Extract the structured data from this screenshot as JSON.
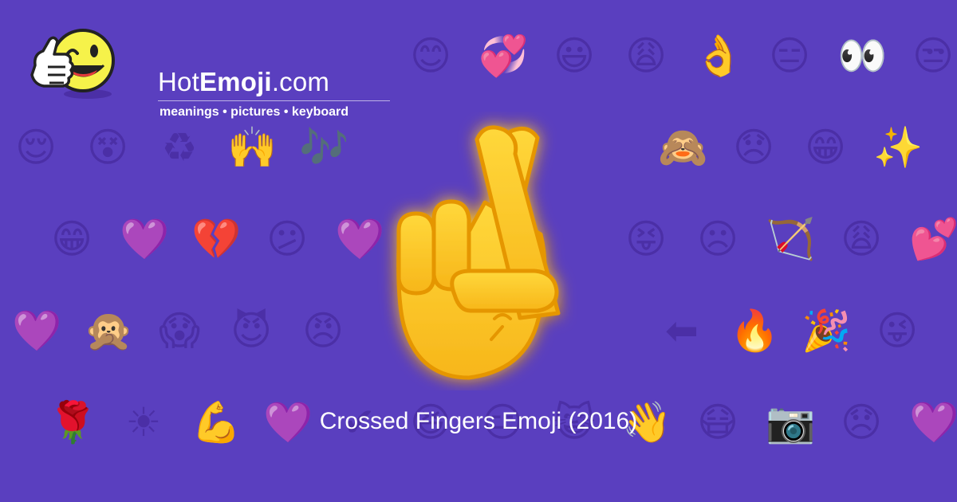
{
  "brand": {
    "name_regular_start": "Hot",
    "name_bold": "Emoji",
    "name_regular_end": ".com",
    "tagline": "meanings • pictures • keyboard",
    "mascot_icon": "winking-thumbs-up-smiley-icon"
  },
  "hero": {
    "emoji_icon": "crossed-fingers-icon",
    "caption": "Crossed Fingers Emoji (2016)"
  },
  "colors": {
    "background": "#5a3fbf",
    "pattern": "#4b2fa6",
    "emoji_yellow": "#fcc21b",
    "emoji_outline": "#e59600"
  },
  "background_pattern_icons": [
    "😊",
    "💞",
    "😃",
    "😩",
    "👌",
    "😑",
    "👀",
    "😒",
    "😌",
    "😵",
    "♻",
    "🙌",
    "🎶",
    "🙈",
    "😞",
    "😁",
    "✨",
    "😁",
    "💜",
    "💔",
    "😕",
    "💜",
    "😝",
    "☹",
    "🏹",
    "😩",
    "💕",
    "💜",
    "🙊",
    "😱",
    "😈",
    "😠",
    "⬅",
    "🔥",
    "🎉",
    "😜",
    "🌹",
    "☀",
    "💪",
    "💜",
    "✔",
    "😆",
    "😑",
    "😺",
    "👋",
    "😷",
    "📷",
    "😞",
    "💜",
    "😀",
    "💓",
    "😚"
  ]
}
